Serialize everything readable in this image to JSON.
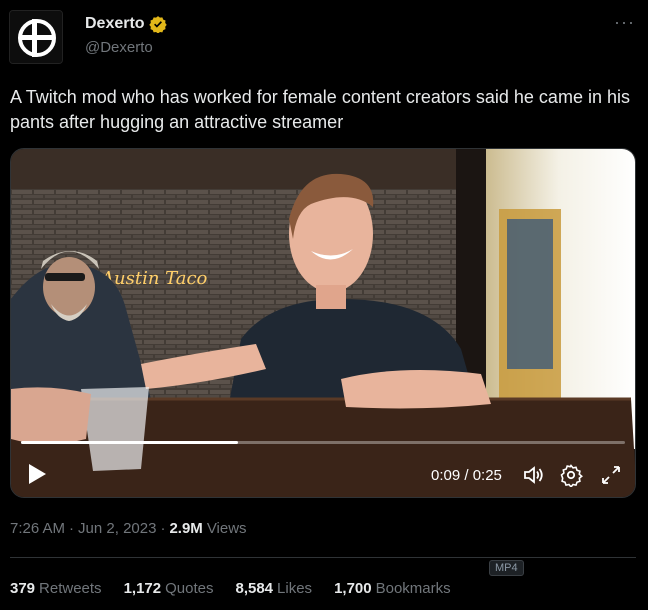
{
  "author": {
    "display_name": "Dexerto",
    "handle": "@Dexerto",
    "verified_color": "#e2b719"
  },
  "more_icon": "···",
  "tweet": {
    "text": "A Twitch mod who has worked for female content creators said he came in his pants after hugging an attractive streamer"
  },
  "video": {
    "time_display": "0:09 / 0:25",
    "progress": 0.36,
    "neon_sign": "Austin Taco",
    "format_badge": "MP4"
  },
  "meta": {
    "time": "7:26 AM",
    "date": "Jun 2, 2023",
    "views_count": "2.9M",
    "views_label": "Views",
    "sep": "·"
  },
  "stats": [
    {
      "num": "379",
      "label": "Retweets"
    },
    {
      "num": "1,172",
      "label": "Quotes"
    },
    {
      "num": "8,584",
      "label": "Likes"
    },
    {
      "num": "1,700",
      "label": "Bookmarks"
    }
  ]
}
